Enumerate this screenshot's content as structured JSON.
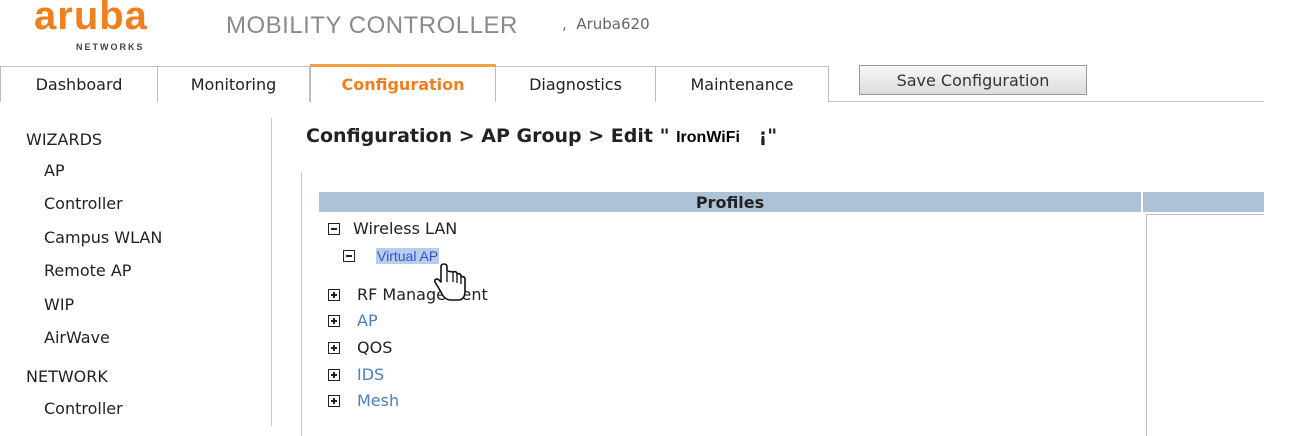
{
  "header": {
    "logo_text": "aruba",
    "logo_subtext": "NETWORKS",
    "product_title": "MOBILITY CONTROLLER",
    "separator": ",",
    "hostname": "Aruba620"
  },
  "tabs": [
    {
      "label": "Dashboard",
      "active": false
    },
    {
      "label": "Monitoring",
      "active": false
    },
    {
      "label": "Configuration",
      "active": true
    },
    {
      "label": "Diagnostics",
      "active": false
    },
    {
      "label": "Maintenance",
      "active": false
    }
  ],
  "toolbar": {
    "save_label": "Save Configuration"
  },
  "sidebar": {
    "sections": [
      {
        "title": "WIZARDS",
        "items": [
          "AP",
          "Controller",
          "Campus WLAN",
          "Remote AP",
          "WIP",
          "AirWave"
        ]
      },
      {
        "title": "NETWORK",
        "items": [
          "Controller"
        ]
      }
    ]
  },
  "breadcrumb": {
    "prefix": "Configuration > AP Group > Edit \"",
    "group_name": "IronWiFi",
    "suffix": "¡\""
  },
  "profiles": {
    "header": "Profiles",
    "tree": [
      {
        "label": "Wireless LAN",
        "expanded": true,
        "style": "normal"
      },
      {
        "label": "Virtual AP",
        "expanded": true,
        "style": "selected"
      },
      {
        "label": "RF Management",
        "expanded": false,
        "style": "normal"
      },
      {
        "label": "AP",
        "expanded": false,
        "style": "link"
      },
      {
        "label": "QOS",
        "expanded": false,
        "style": "normal"
      },
      {
        "label": "IDS",
        "expanded": false,
        "style": "link"
      },
      {
        "label": "Mesh",
        "expanded": false,
        "style": "link"
      }
    ]
  },
  "colors": {
    "brand_orange": "#f07f1e",
    "table_header": "#adc2d6",
    "link_blue": "#4a7fc1"
  }
}
